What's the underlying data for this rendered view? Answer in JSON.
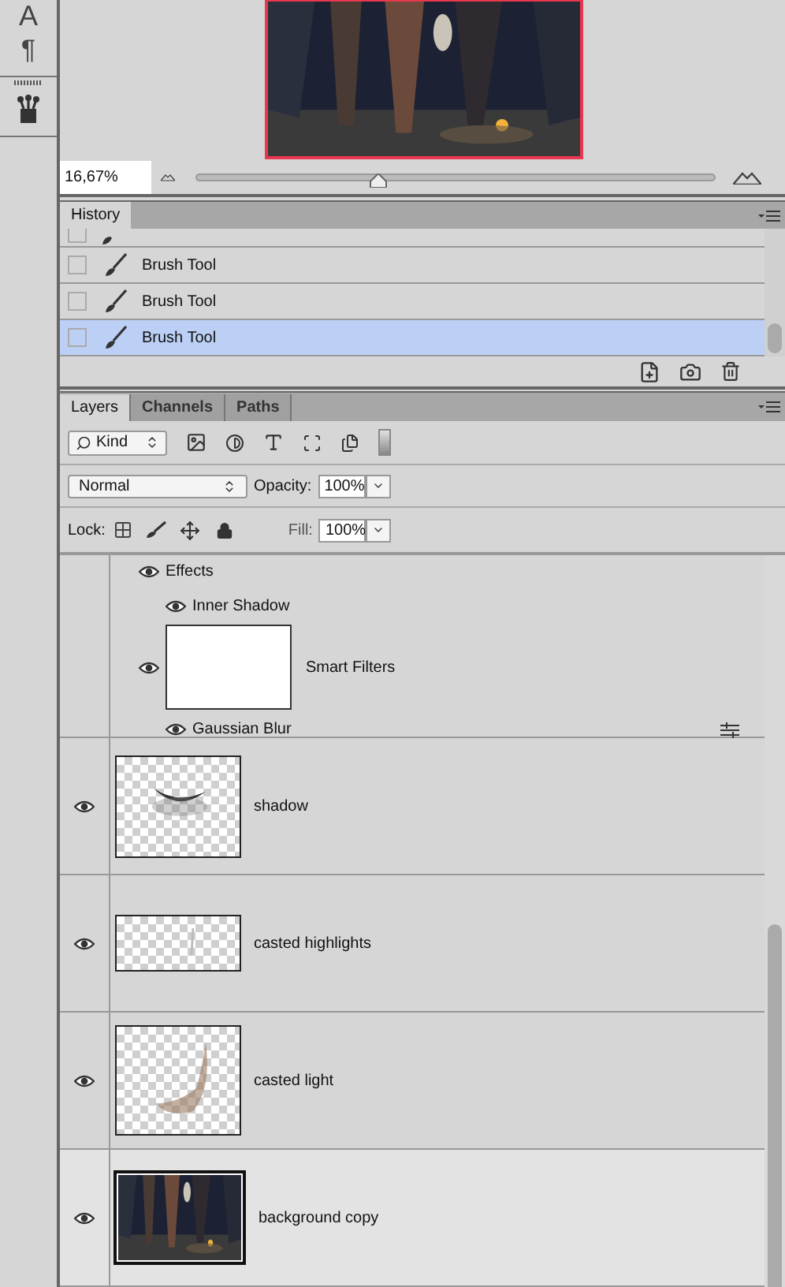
{
  "tools": [
    {
      "glyph": "A"
    },
    {
      "glyph": "¶"
    }
  ],
  "navigator": {
    "zoom": "16,67%",
    "level": 0.35
  },
  "history": {
    "title": "History",
    "items": [
      {
        "cut": true,
        "selected": false
      },
      {
        "label": "Brush Tool",
        "cut": false,
        "selected": false
      },
      {
        "label": "Brush Tool",
        "cut": false,
        "selected": false
      },
      {
        "label": "Brush Tool",
        "cut": false,
        "selected": true
      }
    ]
  },
  "layers_panel": {
    "tabs": [
      {
        "label": "Layers",
        "selected": true
      },
      {
        "label": "Channels",
        "selected": false
      },
      {
        "label": "Paths",
        "selected": false
      }
    ],
    "filter": "Kind",
    "blend_mode": "Normal",
    "opacity_label": "Opacity:",
    "opacity": "100%",
    "lock_label": "Lock:",
    "fill_label": "Fill:",
    "fill": "100%",
    "effects": {
      "label": "Effects",
      "items": [
        "Inner Shadow"
      ],
      "smart_filters": "Smart Filters",
      "filters": [
        "Gaussian Blur"
      ]
    },
    "layers": [
      {
        "name": "shadow",
        "kind": "shadow",
        "visible": true,
        "selected": false
      },
      {
        "name": "casted highlights",
        "kind": "highlights",
        "visible": true,
        "selected": false
      },
      {
        "name": "casted light",
        "kind": "light",
        "visible": true,
        "selected": false
      },
      {
        "name": "background copy",
        "visible": true,
        "selected": true
      }
    ]
  }
}
